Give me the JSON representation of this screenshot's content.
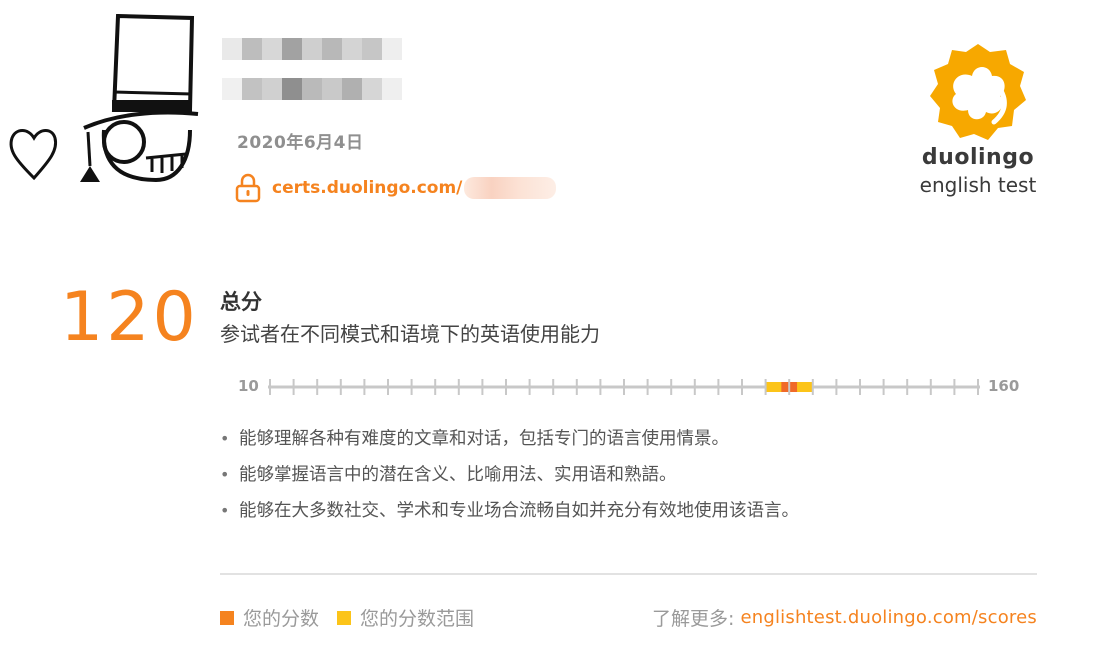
{
  "header": {
    "test_date": "2020年6月4日",
    "cert_link": "certs.duolingo.com/"
  },
  "logo": {
    "word": "duolingo",
    "subtitle": "english test",
    "color": "#f7a800"
  },
  "score": {
    "value": "120",
    "title": "总分",
    "description": "参试者在不同模式和语境下的英语使用能力",
    "scale_min": "10",
    "scale_max": "160",
    "score": 120,
    "range_low": 115,
    "range_high": 125,
    "tick_step": 5
  },
  "bullets": [
    "能够理解各种有难度的文章和对话，包括专门的语言使用情景。",
    "能够掌握语言中的潜在含义、比喻用法、实用语和熟語。",
    "能够在大多数社交、学术和专业场合流畅自如并充分有效地使用该语言。"
  ],
  "legend": {
    "your_score": "您的分数",
    "your_range": "您的分数范围",
    "learn_more_label": "了解更多:",
    "learn_more_url": "englishtest.duolingo.com/scores"
  },
  "colors": {
    "accent": "#f5831f",
    "range": "#fcc419",
    "score_marker": "#f06a29",
    "scale_line": "#c8c8c8"
  }
}
